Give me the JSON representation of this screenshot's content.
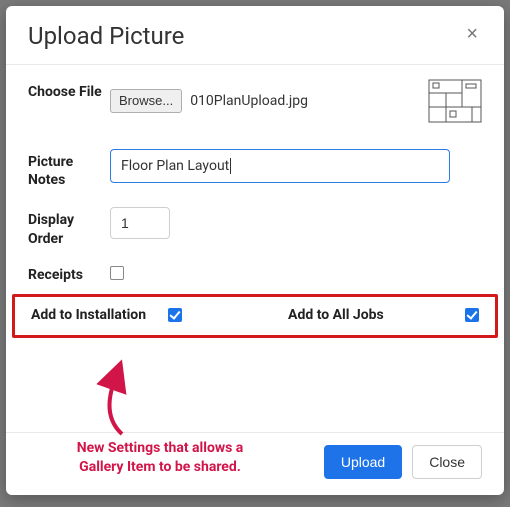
{
  "modal": {
    "title": "Upload Picture",
    "close_glyph": "×"
  },
  "form": {
    "choose_file": {
      "label": "Choose File",
      "browse_label": "Browse...",
      "filename": "010PlanUpload.jpg"
    },
    "picture_notes": {
      "label": "Picture Notes",
      "value": "Floor Plan Layout"
    },
    "display_order": {
      "label": "Display Order",
      "value": "1"
    },
    "receipts": {
      "label": "Receipts",
      "checked": false
    },
    "add_to_installation": {
      "label": "Add to Installation",
      "checked": true
    },
    "add_to_all_jobs": {
      "label": "Add to All Jobs",
      "checked": true
    }
  },
  "annotation": {
    "caption_line1": "New Settings that allows a",
    "caption_line2": "Gallery Item to be shared.",
    "color": "#d11549"
  },
  "footer": {
    "upload_label": "Upload",
    "close_label": "Close"
  }
}
